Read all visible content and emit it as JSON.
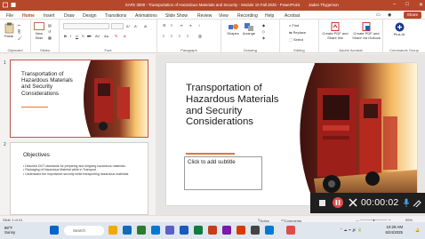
{
  "window": {
    "title": "SAFE 3000 - Transportation of Hazardous Materials and Security - Module 10 Fall 2025  -  PowerPoint",
    "user": "Jaden Thygerson",
    "accent": "#b7472a"
  },
  "tabs": [
    "File",
    "Home",
    "Insert",
    "Draw",
    "Design",
    "Transitions",
    "Animations",
    "Slide Show",
    "Review",
    "View",
    "Recording",
    "Help",
    "Acrobat"
  ],
  "active_tab": "Home",
  "share_label": "Share",
  "ribbon": {
    "clipboard": {
      "paste": "Paste",
      "label": "Clipboard"
    },
    "slides": {
      "new_slide": "New Slide",
      "label": "Slides"
    },
    "font": {
      "label": "Font"
    },
    "paragraph": {
      "label": "Paragraph"
    },
    "drawing": {
      "shapes": "Shapes",
      "arrange": "Arrange",
      "label": "Drawing"
    },
    "editing": {
      "find": "Find",
      "replace": "Replace",
      "select": "Select",
      "label": "Editing"
    },
    "adobe": {
      "create_pdf_share": "Create PDF and Share link",
      "create_pdf_outlook": "Create PDF and Share via Outlook",
      "label": "Adobe Acrobat"
    },
    "copilot": {
      "plus_ai": "Plus AI",
      "label": "Commands Group"
    }
  },
  "thumbnails": [
    {
      "number": "1",
      "title": "Transportation of Hazardous Materials and Security Considerations"
    },
    {
      "number": "2",
      "title": "Objectives",
      "bullets": [
        "Describe DOT standards for preparing and shipping hazardous materials.",
        "Packaging of Hazardous Material while in Transport",
        "Understand the importance security while transporting hazardous materials"
      ]
    }
  ],
  "slide": {
    "title": "Transportation of Hazardous Materials and Security Considerations",
    "subtitle_placeholder": "Click to add subtitle"
  },
  "status": {
    "slide_of": "Slide 1 of 41",
    "notes": "Notes",
    "comments": "Comments",
    "zoom": "59%"
  },
  "recording": {
    "time": "00:00:02"
  },
  "taskbar": {
    "weather_temp": "88°F",
    "weather_desc": "Sunny",
    "search_placeholder": "Search",
    "time": "10:28 AM",
    "date": "6/24/2025"
  }
}
